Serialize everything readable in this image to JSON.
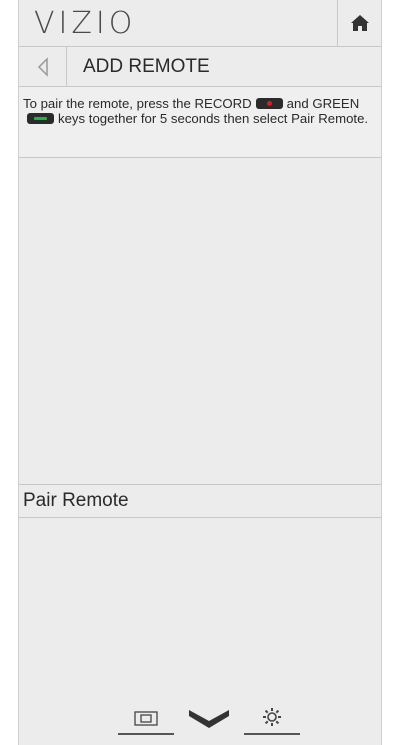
{
  "header": {
    "logo_text": "VIZIO",
    "home_icon": "home-icon"
  },
  "subheader": {
    "back_icon": "back-triangle-icon",
    "title": "ADD REMOTE"
  },
  "instructions": {
    "part1": "To pair the remote, press the RECORD",
    "part2": "and GREEN",
    "part3": "keys together for 5 seconds then select Pair Remote.",
    "record_key_icon": "record-key-icon",
    "green_key_icon": "green-key-icon"
  },
  "menu": {
    "items": [
      {
        "label": "Pair Remote"
      }
    ]
  },
  "bottom_nav": {
    "items": [
      {
        "icon": "input-icon"
      },
      {
        "icon": "vizio-v-icon"
      },
      {
        "icon": "settings-gear-icon"
      }
    ]
  },
  "colors": {
    "panel_bg": "#ececec",
    "record_red": "#e01b24",
    "green_key": "#20b34a",
    "text": "#2a2a2a"
  }
}
